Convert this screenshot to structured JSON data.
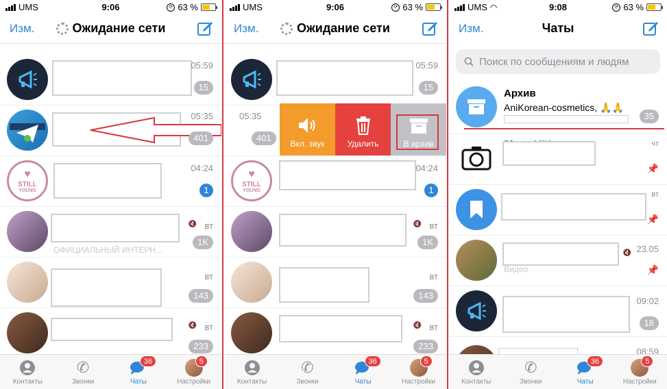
{
  "colors": {
    "accent": "#2f86d6",
    "badge_red": "#e5413f",
    "highlight_red": "#d5373f",
    "swipe_sound": "#f39b2b",
    "swipe_delete": "#e5413f",
    "swipe_archive": "#c2c2c6"
  },
  "status_bar": {
    "carrier": "UMS",
    "battery": "63 %",
    "battery_level": 0.63
  },
  "panels": [
    {
      "time": "9:06",
      "nav": {
        "edit_label": "Изм.",
        "title": "Ожидание сети",
        "compose_icon": "compose-icon"
      },
      "rows": [
        {
          "time": "05:59",
          "badge": "15"
        },
        {
          "time": "05:35",
          "badge": "401"
        },
        {
          "time": "04:24",
          "badge": "1"
        },
        {
          "time": "вт",
          "badge": "1K",
          "faded_text": "ОФИЦИАЛЬНЫЙ ИНТЕРН..."
        },
        {
          "time": "вт",
          "badge": "143"
        },
        {
          "time": "вт",
          "badge": "233"
        }
      ]
    },
    {
      "time": "9:06",
      "nav": {
        "edit_label": "Изм.",
        "title": "Ожидание сети",
        "compose_icon": "compose-icon"
      },
      "rows": [
        {
          "time": "05:59",
          "badge": "15"
        },
        {
          "time": "05:35",
          "badge": "401"
        },
        {
          "time": "04:24",
          "badge": "1"
        },
        {
          "time": "вт",
          "badge": "1K"
        },
        {
          "time": "вт",
          "badge": "143"
        },
        {
          "time": "вт",
          "badge": "233"
        }
      ],
      "swipe_actions": {
        "sound": "Вкл. звук",
        "delete": "Удалить",
        "archive": "В архив"
      }
    },
    {
      "time": "9:08",
      "nav": {
        "edit_label": "Изм.",
        "title": "Чаты",
        "compose_icon": "compose-icon"
      },
      "search_placeholder": "Поиск по сообщениям и людям",
      "archive": {
        "title": "Архив",
        "line": "AniKorean-cosmetics, 🙏🙏",
        "badge": "35"
      },
      "rows": [
        {
          "time": "чт",
          "name_partial": "Photo MIX"
        },
        {
          "time": "вт"
        },
        {
          "time": "23.05",
          "faded_text": "Видео"
        },
        {
          "time": "09:02",
          "badge": "18"
        },
        {
          "time": "08:59"
        }
      ]
    }
  ],
  "tabbar": {
    "contacts": "Контакты",
    "calls": "Звонки",
    "chats": "Чаты",
    "chats_badge": "36",
    "settings": "Настройки",
    "settings_badge": "5"
  }
}
